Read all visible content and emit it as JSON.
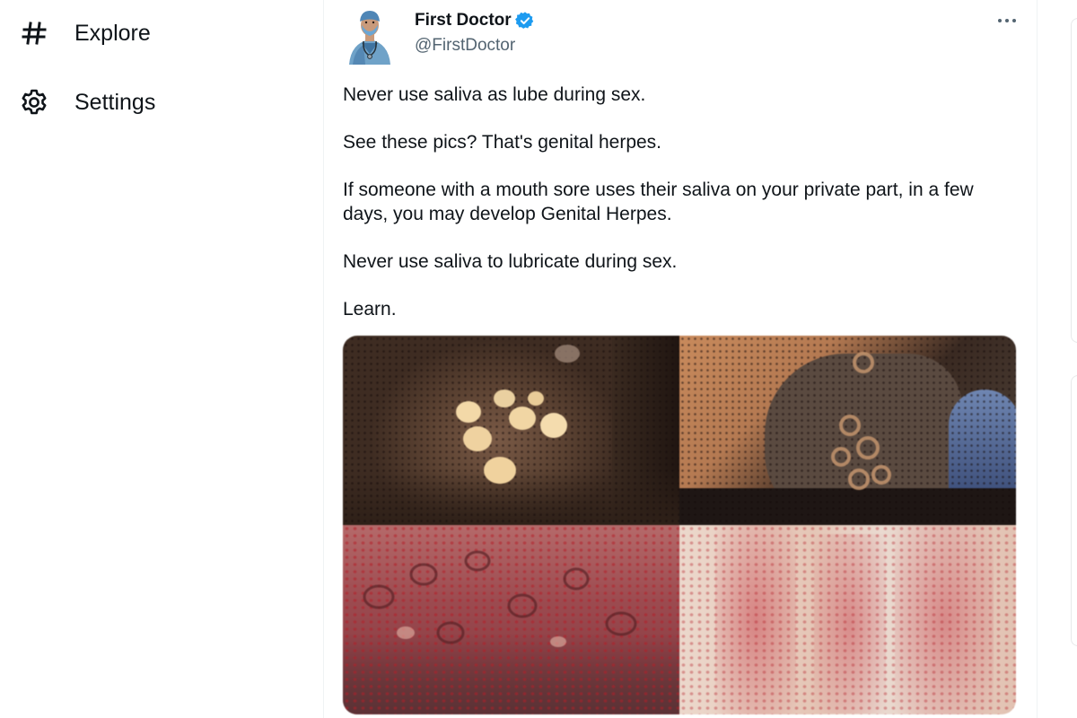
{
  "nav": {
    "items": [
      {
        "label": "Explore",
        "icon": "hashtag-icon"
      },
      {
        "label": "Settings",
        "icon": "gear-icon"
      }
    ]
  },
  "tweet": {
    "author": {
      "name": "First Doctor",
      "handle": "@FirstDoctor",
      "verified": true,
      "verified_color": "#1d9bf0"
    },
    "text_paragraphs": [
      "Never use saliva as lube during sex.",
      "See these pics? That's genital herpes.",
      "If someone with a mouth sore uses their saliva on your private part, in a few days, you may develop Genital Herpes.",
      "Never use saliva to lubricate during sex.",
      "Learn."
    ],
    "media_count": 4
  },
  "colors": {
    "text_primary": "#0f1419",
    "text_secondary": "#536471",
    "border": "#eff3f4"
  }
}
